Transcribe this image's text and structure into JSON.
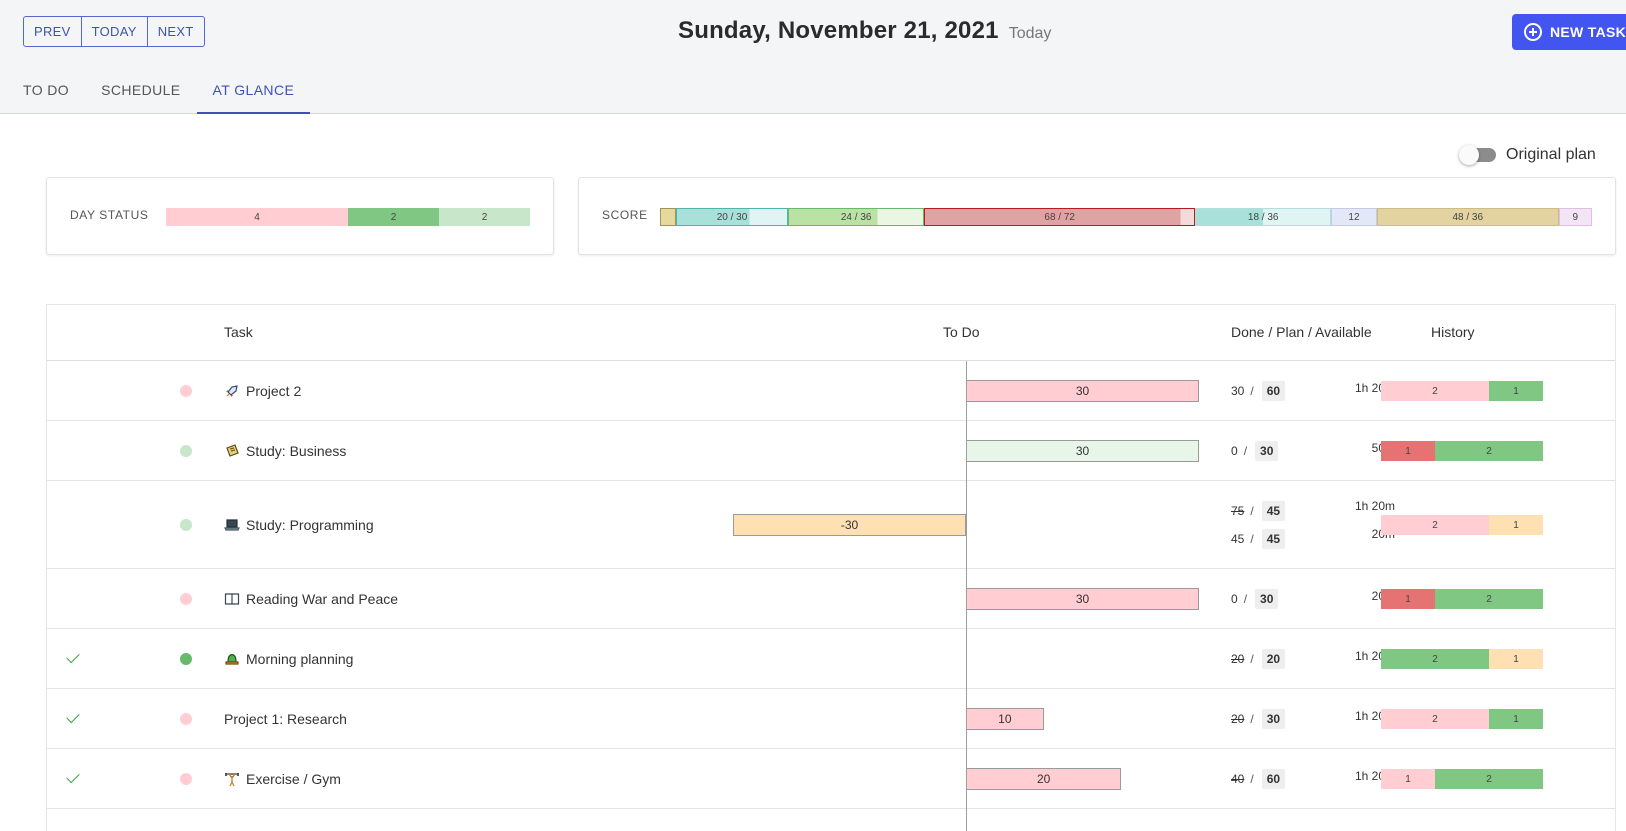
{
  "header": {
    "nav": {
      "prev": "PREV",
      "today": "TODAY",
      "next": "NEXT"
    },
    "date": "Sunday, November 21, 2021",
    "today_label": "Today",
    "new_task": "NEW TASK"
  },
  "tabs": [
    {
      "label": "TO DO",
      "active": false
    },
    {
      "label": "SCHEDULE",
      "active": false
    },
    {
      "label": "AT GLANCE",
      "active": true
    }
  ],
  "toggle": {
    "label": "Original plan",
    "on": false
  },
  "day_status": {
    "label": "DAY STATUS",
    "segments": [
      {
        "value": "4",
        "weight": 4,
        "color": "#ffcdd2"
      },
      {
        "value": "2",
        "weight": 2,
        "color": "#81c784"
      },
      {
        "value": "2",
        "weight": 2,
        "color": "#c8e6c9"
      }
    ]
  },
  "score": {
    "label": "SCORE",
    "segments": [
      {
        "label": "",
        "weight": 15,
        "color": "#e6d99a",
        "border": "#9e9460"
      },
      {
        "label": "20 / 30",
        "weight": 108,
        "color": "#a8e0da",
        "border": "#4db6ac",
        "inner_split": 0.66,
        "inner_color": "#e0f5f3"
      },
      {
        "label": "24 / 36",
        "weight": 130,
        "color": "#b9e2a4",
        "border": "#66bb6a",
        "inner_split": 0.66,
        "inner_color": "#eaf6e2"
      },
      {
        "label": "68 / 72",
        "weight": 260,
        "color": "#e0a3a3",
        "border": "#b71c1c",
        "inner_split": 0.95,
        "inner_color": "#f6dada"
      },
      {
        "label": "18 / 36",
        "weight": 130,
        "color": "#a8e0da",
        "border": "#b2dfdb",
        "inner_split": 0.5,
        "inner_color": "#e0f5f3"
      },
      {
        "label": "12",
        "weight": 44,
        "color": "#e3e8f8",
        "border": "#c5cae9"
      },
      {
        "label": "48 / 36",
        "weight": 174,
        "color": "#e2d3a0",
        "border": "#cdbc84"
      },
      {
        "label": "9",
        "weight": 32,
        "color": "#f3e5f5",
        "border": "#e1bee7"
      }
    ]
  },
  "table": {
    "headers": {
      "task": "Task",
      "todo": "To Do",
      "dpa": "Done / Plan / Available",
      "history": "History"
    },
    "rows": [
      {
        "checked": false,
        "dot": "#ffcdd2",
        "name": "Project 2",
        "icon": "rocket",
        "todo": {
          "value": "30",
          "amount": 30,
          "color": "#ffcdd2"
        },
        "entries": [
          {
            "done": "30",
            "struck": false,
            "plan": "60",
            "avail": "1h 20m"
          }
        ],
        "history": [
          {
            "value": "2",
            "weight": 2,
            "color": "#ffcdd2"
          },
          {
            "value": "1",
            "weight": 1,
            "color": "#81c784"
          }
        ]
      },
      {
        "checked": false,
        "dot": "#c8e6c9",
        "name": "Study: Business",
        "icon": "scroll",
        "todo": {
          "value": "30",
          "amount": 30,
          "color": "#e8f5e9"
        },
        "entries": [
          {
            "done": "0",
            "struck": false,
            "plan": "30",
            "avail": "50m"
          }
        ],
        "history": [
          {
            "value": "1",
            "weight": 1,
            "color": "#e57373"
          },
          {
            "value": "2",
            "weight": 2,
            "color": "#81c784"
          }
        ]
      },
      {
        "checked": false,
        "dot": "#c8e6c9",
        "name": "Study: Programming",
        "icon": "laptop",
        "todo": {
          "value": "-30",
          "amount": -30,
          "color": "#ffe0b2"
        },
        "entries": [
          {
            "done": "75",
            "struck": true,
            "plan": "45",
            "avail": "1h 20m"
          },
          {
            "done": "45",
            "struck": false,
            "plan": "45",
            "avail": "20m"
          }
        ],
        "history": [
          {
            "value": "2",
            "weight": 2,
            "color": "#ffcdd2"
          },
          {
            "value": "1",
            "weight": 1,
            "color": "#ffe0b2"
          }
        ]
      },
      {
        "checked": false,
        "dot": "#ffcdd2",
        "name": "Reading War and Peace",
        "icon": "book",
        "todo": {
          "value": "30",
          "amount": 30,
          "color": "#ffcdd2"
        },
        "entries": [
          {
            "done": "0",
            "struck": false,
            "plan": "30",
            "avail": "20m"
          }
        ],
        "history": [
          {
            "value": "1",
            "weight": 1,
            "color": "#e57373"
          },
          {
            "value": "2",
            "weight": 2,
            "color": "#81c784"
          }
        ]
      },
      {
        "checked": true,
        "dot": "#66bb6a",
        "name": "Morning planning",
        "icon": "bell",
        "todo": null,
        "entries": [
          {
            "done": "20",
            "struck": true,
            "plan": "20",
            "avail": "1h 20m"
          }
        ],
        "history": [
          {
            "value": "2",
            "weight": 2,
            "color": "#81c784"
          },
          {
            "value": "1",
            "weight": 1,
            "color": "#ffe0b2"
          }
        ]
      },
      {
        "checked": true,
        "dot": "#ffcdd2",
        "name": "Project 1: Research",
        "icon": "",
        "todo": {
          "value": "10",
          "amount": 10,
          "color": "#ffcdd2"
        },
        "entries": [
          {
            "done": "20",
            "struck": true,
            "plan": "30",
            "avail": "1h 20m"
          }
        ],
        "history": [
          {
            "value": "2",
            "weight": 2,
            "color": "#ffcdd2"
          },
          {
            "value": "1",
            "weight": 1,
            "color": "#81c784"
          }
        ]
      },
      {
        "checked": true,
        "dot": "#ffcdd2",
        "name": "Exercise / Gym",
        "icon": "weightlifter",
        "todo": {
          "value": "20",
          "amount": 20,
          "color": "#ffcdd2"
        },
        "entries": [
          {
            "done": "40",
            "struck": true,
            "plan": "60",
            "avail": "1h 20m"
          }
        ],
        "history": [
          {
            "value": "1",
            "weight": 1,
            "color": "#ffcdd2"
          },
          {
            "value": "2",
            "weight": 2,
            "color": "#81c784"
          }
        ]
      }
    ]
  }
}
